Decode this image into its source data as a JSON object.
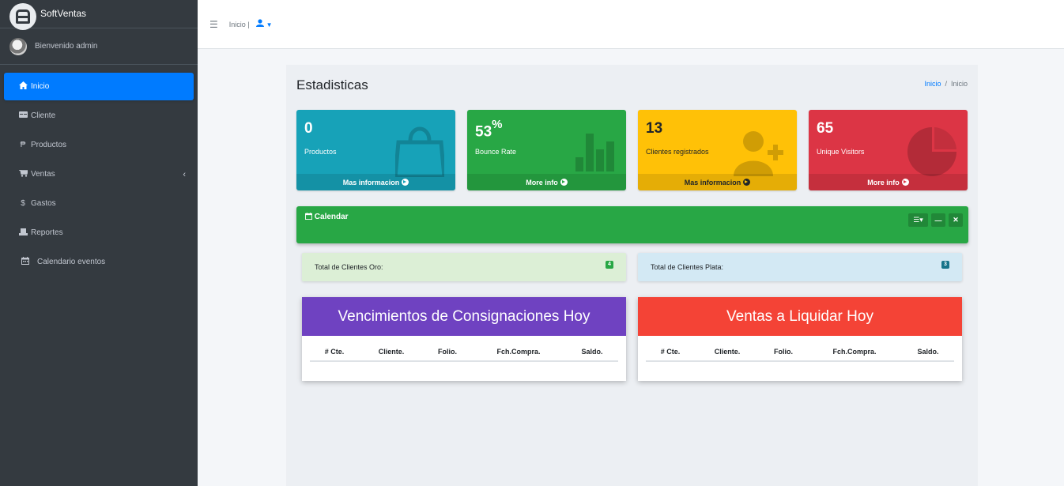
{
  "brand": {
    "name": "SoftVentas"
  },
  "user": {
    "welcome": "Bienvenido admin"
  },
  "sidebar": {
    "items": [
      {
        "label": "Inicio",
        "icon": "home-icon"
      },
      {
        "label": "Cliente",
        "icon": "id-card-icon"
      },
      {
        "label": "Productos",
        "icon": "peso-icon"
      },
      {
        "label": "Ventas",
        "icon": "cart-icon"
      },
      {
        "label": "Gastos",
        "icon": "dollar-icon"
      },
      {
        "label": "Reportes",
        "icon": "report-icon"
      },
      {
        "label": "Calendario eventos",
        "icon": "calendar-icon"
      }
    ]
  },
  "topbar": {
    "home_link": "Inicio |"
  },
  "page": {
    "title": "Estadisticas",
    "breadcrumb": {
      "link": "Inicio",
      "separator": "/",
      "current": "Inicio"
    }
  },
  "boxes": [
    {
      "value": "0",
      "label": "Productos",
      "footer": "Mas informacion"
    },
    {
      "value": "53",
      "suffix": "%",
      "label": "Bounce Rate",
      "footer": "More info"
    },
    {
      "value": "13",
      "label": "Clientes registrados",
      "footer": "Mas informacion"
    },
    {
      "value": "65",
      "label": "Unique Visitors",
      "footer": "More info"
    }
  ],
  "calendar": {
    "title": "Calendar"
  },
  "cards": {
    "oro": {
      "label": "Total de Clientes Oro:",
      "count": "4"
    },
    "plata": {
      "label": "Total de Clientes Plata:",
      "count": "3"
    }
  },
  "tables": {
    "vencimientos": {
      "title": "Vencimientos de Consignaciones Hoy",
      "columns": [
        "# Cte.",
        "Cliente.",
        "Folio.",
        "Fch.Compra.",
        "Saldo."
      ]
    },
    "ventas": {
      "title": "Ventas a Liquidar Hoy",
      "columns": [
        "# Cte.",
        "Cliente.",
        "Folio.",
        "Fch.Compra.",
        "Saldo."
      ]
    }
  },
  "colors": {
    "sidebar": "#343a40",
    "active": "#007bff",
    "info": "#17a2b8",
    "success": "#28a745",
    "warning": "#ffc107",
    "danger": "#dc3545",
    "purple": "#6f42c1",
    "red": "#f44336"
  }
}
